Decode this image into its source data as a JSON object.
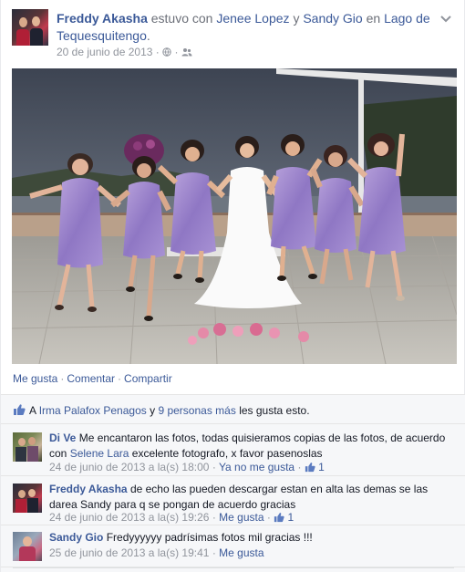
{
  "post": {
    "author": "Freddy Akasha",
    "verb": "estuvo con",
    "with1": "Jenee Lopez",
    "conj": "y",
    "with2": "Sandy Gio",
    "prep": "en",
    "place": "Lago de Tequesquitengo",
    "period": ".",
    "date": "20 de junio de 2013",
    "meta_sep": "·"
  },
  "actions": {
    "like": "Me gusta",
    "comment": "Comentar",
    "share": "Compartir",
    "sep": "·"
  },
  "likes": {
    "prefix": "A",
    "person": "Irma Palafox Penagos",
    "conj": "y",
    "others": "9 personas más",
    "suffix": "les gusta esto."
  },
  "comments": [
    {
      "author": "Di Ve",
      "text_a": "Me encantaron las fotos, todas quisieramos copias de las fotos, de acuerdo con",
      "mention": "Selene Lara",
      "text_b": "excelente fotografo, x favor pasenoslas",
      "time": "24 de junio de 2013 a la(s) 18:00",
      "action": "Ya no me gusta",
      "likes": "1"
    },
    {
      "author": "Freddy Akasha",
      "text_a": "de echo las pueden descargar estan en alta las demas se las darea Sandy para q se pongan de acuerdo gracias",
      "time": "24 de junio de 2013 a la(s) 19:26",
      "action": "Me gusta",
      "likes": "1"
    },
    {
      "author": "Sandy Gio",
      "text_a": "Fredyyyyyy padrísimas fotos mil gracias !!!",
      "time": "25 de junio de 2013 a la(s) 19:41",
      "action": "Me gusta"
    }
  ],
  "icons": {
    "globe": "globe-icon",
    "friends": "friends-icon",
    "chevron": "chevron-down-icon",
    "thumb": "thumbs-up-icon"
  },
  "colors": {
    "link": "#3b5998",
    "meta": "#90949c",
    "background_comments": "#f6f7f9"
  }
}
